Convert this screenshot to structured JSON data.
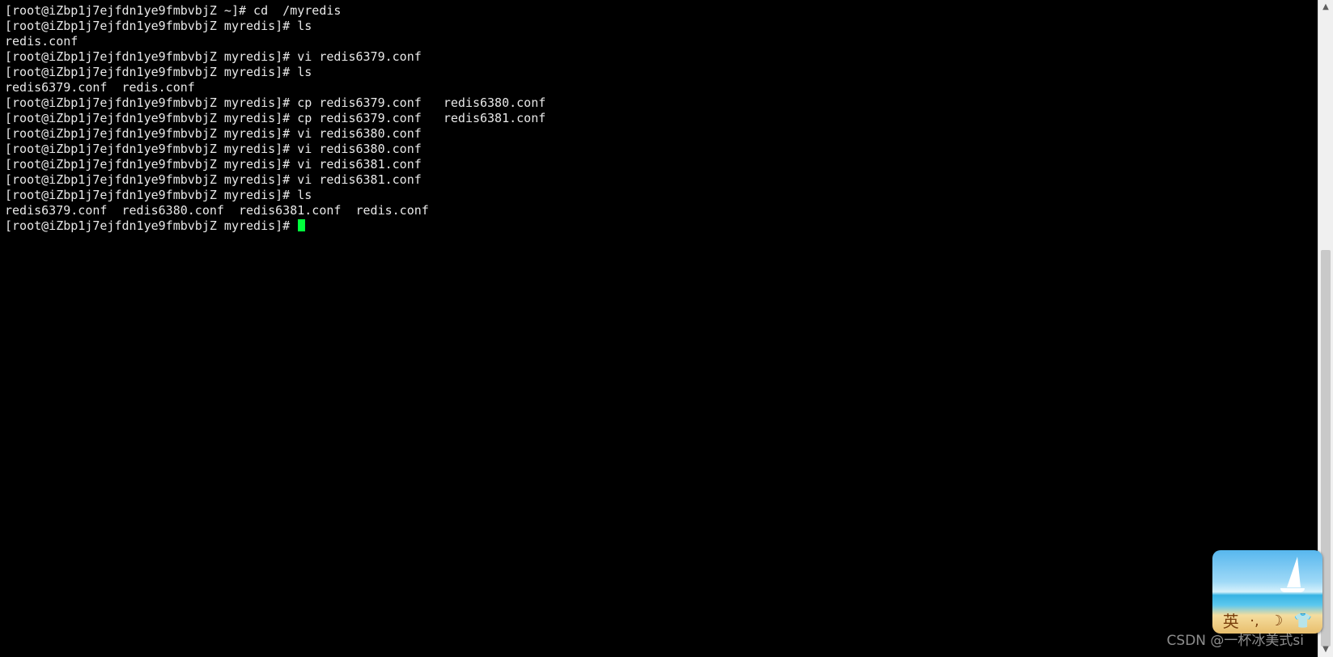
{
  "terminal": {
    "lines": [
      "[root@iZbp1j7ejfdn1ye9fmbvbjZ ~]# cd  /myredis",
      "[root@iZbp1j7ejfdn1ye9fmbvbjZ myredis]# ls",
      "redis.conf",
      "[root@iZbp1j7ejfdn1ye9fmbvbjZ myredis]# vi redis6379.conf",
      "[root@iZbp1j7ejfdn1ye9fmbvbjZ myredis]# ls",
      "redis6379.conf  redis.conf",
      "[root@iZbp1j7ejfdn1ye9fmbvbjZ myredis]# cp redis6379.conf   redis6380.conf",
      "[root@iZbp1j7ejfdn1ye9fmbvbjZ myredis]# cp redis6379.conf   redis6381.conf",
      "[root@iZbp1j7ejfdn1ye9fmbvbjZ myredis]# vi redis6380.conf",
      "[root@iZbp1j7ejfdn1ye9fmbvbjZ myredis]# vi redis6380.conf",
      "[root@iZbp1j7ejfdn1ye9fmbvbjZ myredis]# vi redis6381.conf",
      "[root@iZbp1j7ejfdn1ye9fmbvbjZ myredis]# vi redis6381.conf",
      "[root@iZbp1j7ejfdn1ye9fmbvbjZ myredis]# ls",
      "redis6379.conf  redis6380.conf  redis6381.conf  redis.conf"
    ],
    "current_prompt": "[root@iZbp1j7ejfdn1ye9fmbvbjZ myredis]# ",
    "cursor_color": "#00ff3c",
    "background_color": "#000000",
    "text_color": "#e8e8e8"
  },
  "scrollbar": {
    "up_icon": "chevron-up-icon",
    "down_icon": "chevron-down-icon",
    "up_glyph": "▲",
    "down_glyph": "▼"
  },
  "ime_widget": {
    "language_label": "英",
    "icons": [
      "punctuation-icon",
      "moon-icon",
      "skin-icon"
    ],
    "punctuation_glyph": "·,",
    "moon_glyph": "☽",
    "skin_glyph": "👕"
  },
  "watermark": {
    "text": "CSDN @一杯冰美式si"
  }
}
